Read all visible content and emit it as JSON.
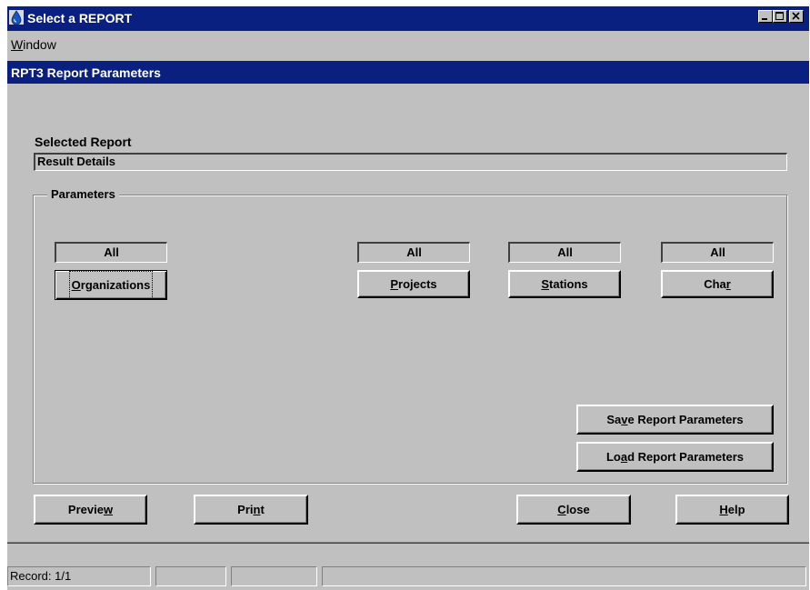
{
  "window": {
    "title": "Select a REPORT"
  },
  "menu": {
    "window_prefix": "W",
    "window_rest": "indow"
  },
  "form": {
    "title": "RPT3 Report Parameters",
    "selected_report_label": "Selected Report",
    "selected_report_value": "Result Details",
    "parameters_label": "Parameters"
  },
  "params": {
    "organizations": {
      "value": "All",
      "btn_ul": "O",
      "btn_rest": "rganizations"
    },
    "projects": {
      "value": "All",
      "btn_ul": "P",
      "btn_rest": "rojects"
    },
    "stations": {
      "value": "All",
      "btn_ul": "S",
      "btn_rest": "tations"
    },
    "char": {
      "value": "All",
      "btn_pre": "Cha",
      "btn_ul": "r"
    }
  },
  "buttons": {
    "save": {
      "pre": "Sa",
      "ul": "v",
      "post": "e Report Parameters"
    },
    "load": {
      "pre": "Lo",
      "ul": "a",
      "post": "d Report Parameters"
    },
    "preview": {
      "pre": "Previe",
      "ul": "w"
    },
    "print": {
      "pre": "Pri",
      "ul": "n",
      "post": "t"
    },
    "close": {
      "ul": "C",
      "post": "lose"
    },
    "help": {
      "ul": "H",
      "post": "elp"
    }
  },
  "status": {
    "record": "Record: 1/1"
  },
  "colors": {
    "titlebar": "#0a2080",
    "face": "#c0c0c0"
  }
}
